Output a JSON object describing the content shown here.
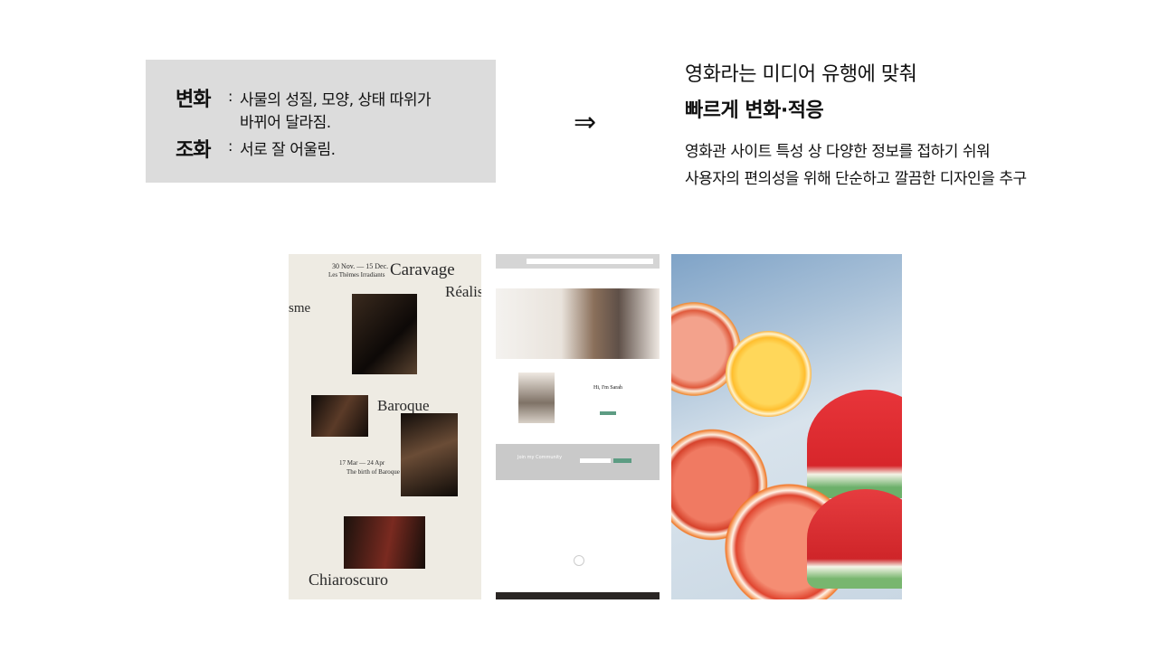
{
  "definitions": [
    {
      "term": "변화",
      "colon": ":",
      "lines": [
        "사물의 성질, 모양, 상태 따위가",
        "바뀌어 달라짐."
      ]
    },
    {
      "term": "조화",
      "colon": ":",
      "lines": [
        "서로 잘 어울림."
      ]
    }
  ],
  "arrow": "⇒",
  "right": {
    "line1": "영화라는 미디어 유행에 맞춰",
    "line2": "빠르게 변화·적응",
    "line3": "영화관 사이트 특성 상 다양한 정보를 접하기 쉬워",
    "line4": "사용자의 편의성을 위해 단순하고 깔끔한 디자인을 추구"
  },
  "poster": {
    "caravage": "Caravage",
    "realis": "Réalis",
    "sme": "sme",
    "dates1": "30 Nov. — 15 Dec.",
    "subtitle1": "Les Thèmes Irradiants",
    "baroque": "Baroque",
    "dates2": "17 Mar — 24 Apr",
    "subtitle2": "The birth of Baroque",
    "chiaroscuro": "Chiaroscuro"
  },
  "site": {
    "greeting": "Hi, I'm Sarah",
    "community": "Join my Community"
  }
}
